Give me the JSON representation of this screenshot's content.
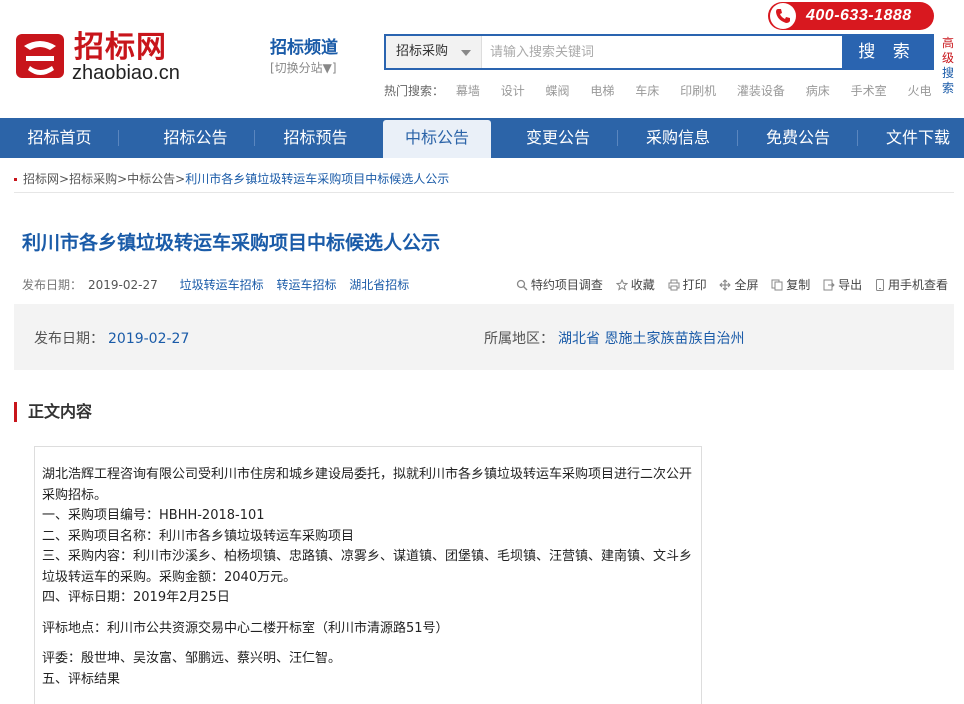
{
  "header": {
    "logo_cn": "招标网",
    "logo_en": "zhaobiao.cn",
    "channel_title": "招标频道",
    "channel_switch": "[切换分站▼]",
    "phone": "400-633-1888",
    "search": {
      "category": "招标采购",
      "placeholder": "请输入搜索关键词",
      "button": "搜 索"
    },
    "advanced": [
      "高级",
      "搜索"
    ],
    "hot_label": "热门搜索：",
    "hot_items": [
      "幕墙",
      "设计",
      "蝶阀",
      "电梯",
      "车床",
      "印刷机",
      "灌装设备",
      "病床",
      "手术室",
      "火电"
    ]
  },
  "nav": {
    "items": [
      "招标首页",
      "招标公告",
      "招标预告",
      "中标公告",
      "变更公告",
      "采购信息",
      "免费公告",
      "文件下载"
    ],
    "active_index": 3
  },
  "breadcrumb": {
    "items": [
      "招标网",
      "招标采购",
      "中标公告"
    ],
    "separator": ">",
    "current": "利川市各乡镇垃圾转运车采购项目中标候选人公示"
  },
  "article": {
    "title": "利川市各乡镇垃圾转运车采购项目中标候选人公示",
    "date_label": "发布日期：",
    "date": "2019-02-27",
    "tags": [
      "垃圾转运车招标",
      "转运车招标",
      "湖北省招标"
    ],
    "tools": [
      "特约项目调查",
      "收藏",
      "打印",
      "全屏",
      "复制",
      "导出",
      "用手机查看"
    ],
    "info": {
      "date_label": "发布日期：",
      "date": "2019-02-27",
      "region_label": "所属地区：",
      "region": "湖北省 恩施土家族苗族自治州"
    },
    "section_title": "正文内容",
    "body": [
      "湖北浩辉工程咨询有限公司受利川市住房和城乡建设局委托，拟就利川市各乡镇垃圾转运车采购项目进行二次公开采购招标。",
      "一、采购项目编号：HBHH-2018-101",
      "二、采购项目名称：利川市各乡镇垃圾转运车采购项目",
      "三、采购内容：利川市沙溪乡、柏杨坝镇、忠路镇、凉雾乡、谋道镇、团堡镇、毛坝镇、汪营镇、建南镇、文斗乡垃圾转运车的采购。采购金额：2040万元。",
      "四、评标日期：2019年2月25日",
      "评标地点：利川市公共资源交易中心二楼开标室（利川市清源路51号）",
      "评委：殷世坤、吴汝富、邹鹏远、蔡兴明、汪仁智。",
      "五、评标结果"
    ]
  },
  "colors": {
    "brand_red": "#c8151b",
    "nav_blue": "#2c64a8",
    "link_blue": "#1a5ba8"
  }
}
